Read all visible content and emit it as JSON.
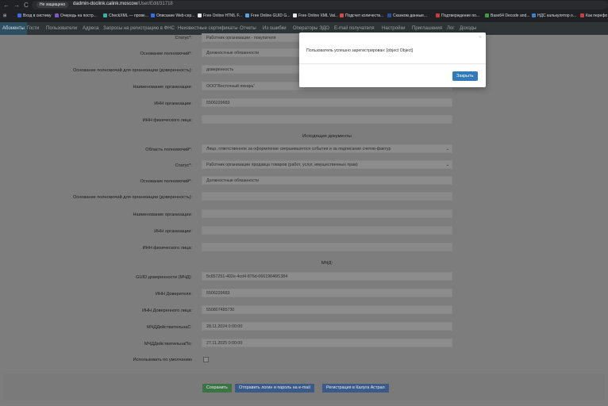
{
  "browser": {
    "back_icon": "←",
    "forward_icon": "→",
    "reload_icon": "C",
    "security_warning": "Не защищено",
    "url_host": "dadmin-doclink.calink.moscow",
    "url_path": "/User/Edit/31718"
  },
  "bookmarks": [
    {
      "label": "Вход в систему",
      "color": "#3c6ad9"
    },
    {
      "label": "Очередь на постр...",
      "color": "#7d58c6"
    },
    {
      "label": "CheckXML — прове...",
      "color": "#3bb2a0"
    },
    {
      "label": "Описание Web-сер...",
      "color": "#2e6ee6"
    },
    {
      "label": "Free Online HTML F...",
      "color": "#e8e8e8"
    },
    {
      "label": "Free Online GUID G...",
      "color": "#5aa3e0"
    },
    {
      "label": "Free Online XML Val...",
      "color": "#e8e8e8"
    },
    {
      "label": "Подсчет количеств...",
      "color": "#d84a4a"
    },
    {
      "label": "Сканком данные...",
      "color": "#2d4f9a"
    },
    {
      "label": "Подтверждение по...",
      "color": "#c93c3c"
    },
    {
      "label": "Base64 Decode and...",
      "color": "#3f9e45"
    },
    {
      "label": "НДС калькулятор о...",
      "color": "#3a7fd0"
    },
    {
      "label": "Как перефо",
      "color": "#c94040"
    }
  ],
  "app_nav": [
    "Абоненты",
    "Гости",
    "Пользователи",
    "Адреса",
    "Запросы на регистрацию в ФНС",
    "Неизвестные сертификаты",
    "Отчеты",
    "Из ошибки",
    "Операторы ЭДО",
    "E-mail получателя",
    "Настройки",
    "Приглашения",
    "Лог",
    "Доходы"
  ],
  "form": {
    "top_rows": [
      {
        "label": "Статус*:",
        "value": "Работник организации - покупателя"
      },
      {
        "label": "Основание полномочий*:",
        "value": "Должностные обязанности"
      },
      {
        "label": "Основание полномочий для организации (доверенность):",
        "value": "доверенность"
      },
      {
        "label": "Наименование организации:",
        "value": "ООО\"Восточный пекарь\""
      },
      {
        "label": "ИНН организации:",
        "value": "5506229683"
      },
      {
        "label": "ИНН физического лица:",
        "value": ""
      }
    ],
    "outgoing_title": "Исходящие документы",
    "outgoing_rows": [
      {
        "label": "Область полномочий*:",
        "value": "Лицо, ответственное за оформление свершившегося события и за подписание счетов-фактур",
        "select": true
      },
      {
        "label": "Статус*:",
        "value": "Работник организации продавца товаров (работ, услуг, имущественных прав)",
        "select": true
      },
      {
        "label": "Основание полномочий*:",
        "value": "Должностные обязанности",
        "select": false
      },
      {
        "label": "Основание полномочий для организации (доверенность):",
        "value": "",
        "select": false
      },
      {
        "label": "Наименование организации:",
        "value": "",
        "select": false
      },
      {
        "label": "ИНН организации:",
        "value": "",
        "select": false
      },
      {
        "label": "ИНН физического лица:",
        "value": "",
        "select": false
      }
    ],
    "mchd_title": "МЧД:",
    "mchd_rows": [
      {
        "label": "GUID доверенности (МЧД):",
        "value": "5c657251-402e-4cd4-876d-06619646f1384"
      },
      {
        "label": "ИНН Доверителя:",
        "value": "5506229683"
      },
      {
        "label": "ИНН Доверенного лица:",
        "value": "550807485730"
      },
      {
        "label": "МЧДДействительнаС:",
        "value": "28.11.2024 0:00:00"
      },
      {
        "label": "МЧДДействительнаПо:",
        "value": "27.11.2025 0:00:00"
      }
    ],
    "use_default_label": "Использовать по умолчанию"
  },
  "buttons": {
    "save": "Сохранить",
    "send_login": "Отправить логин и пароль на e-mail",
    "register_kaluga": "Регистрация в Калуга Астрал"
  },
  "modal": {
    "message": "Пользователь успешно зарегистрирован: [object Object]",
    "close_label": "Закрыть",
    "close_icon": "×"
  }
}
